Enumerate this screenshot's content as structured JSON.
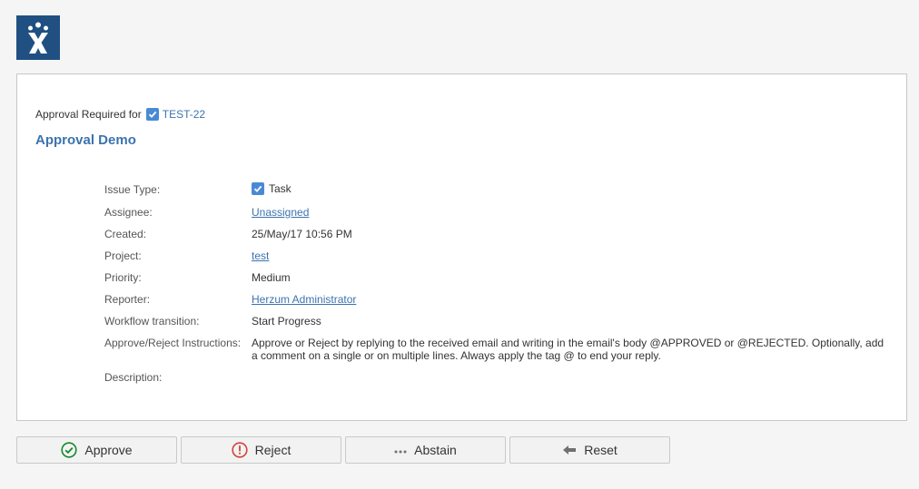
{
  "header": {
    "logo_icon": "jira-logo-icon",
    "logo_color": "#205081"
  },
  "card": {
    "approval_prefix": "Approval Required for",
    "issue_key": "TEST-22",
    "issue_icon": "task-check-icon",
    "title": "Approval Demo"
  },
  "fields": {
    "issue_type": {
      "label": "Issue Type:",
      "value": "Task"
    },
    "assignee": {
      "label": "Assignee:",
      "value": "Unassigned"
    },
    "created": {
      "label": "Created:",
      "value": "25/May/17 10:56 PM"
    },
    "project": {
      "label": "Project:",
      "value": "test"
    },
    "priority": {
      "label": "Priority:",
      "value": "Medium"
    },
    "reporter": {
      "label": "Reporter:",
      "value": "Herzum Administrator"
    },
    "workflow": {
      "label": "Workflow transition:",
      "value": "Start Progress"
    },
    "instructions": {
      "label": "Approve/Reject Instructions:",
      "value": "Approve or Reject by replying to the received email and writing in the email's body @APPROVED or @REJECTED. Optionally, add a comment on a single or on multiple lines. Always apply the tag @ to end your reply."
    },
    "description": {
      "label": "Description:"
    }
  },
  "actions": {
    "approve": {
      "label": "Approve",
      "icon": "check-circle-icon",
      "color": "#14892c"
    },
    "reject": {
      "label": "Reject",
      "icon": "exclamation-circle-icon",
      "color": "#d04437"
    },
    "abstain": {
      "label": "Abstain",
      "icon": "ellipsis-icon",
      "color": "#707070"
    },
    "reset": {
      "label": "Reset",
      "icon": "arrow-left-icon",
      "color": "#707070"
    }
  },
  "colors": {
    "link": "#3b73af",
    "task_icon": "#4a8ad4"
  }
}
